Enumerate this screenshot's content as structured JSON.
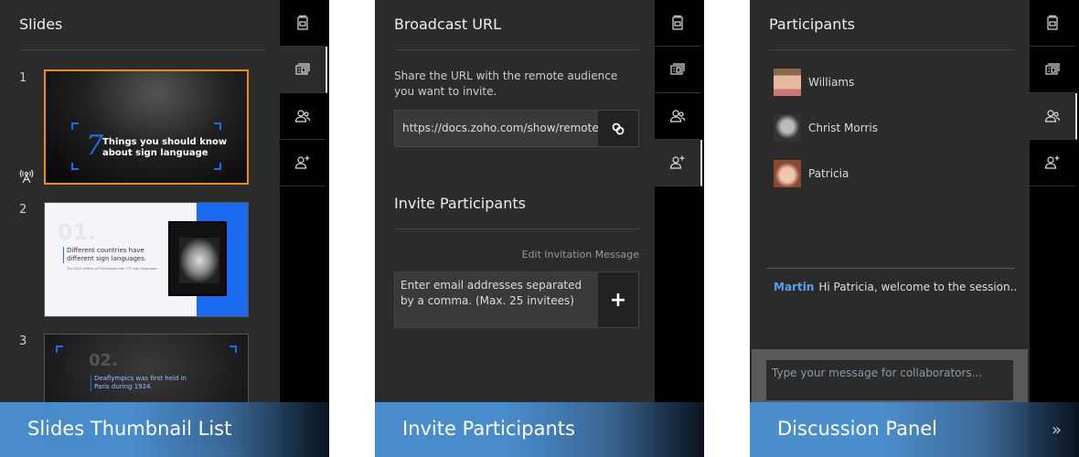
{
  "rail_icons": [
    "notes-icon",
    "slides-icon",
    "participants-icon",
    "add-participant-icon"
  ],
  "colors": {
    "accent": "#4a90d2",
    "selected_border": "#f08a1c",
    "sender": "#5aa0f0",
    "panel": "#2b2b2b"
  },
  "slides_panel": {
    "title": "Slides",
    "caption": "Slides Thumbnail List",
    "active_tab": "slides",
    "slides": [
      {
        "number": "1",
        "big": "7",
        "title": "Things you should know about sign language",
        "selected": true,
        "broadcasting": true
      },
      {
        "number": "2",
        "big": "01.",
        "title": "Different countries have different sign languages.",
        "subtitle": "The 2013 edition of Ethnologue lists 137 sign languages."
      },
      {
        "number": "3",
        "big": "02.",
        "title": "Deaflympics was first held in Paris during 1924."
      }
    ]
  },
  "invite_panel": {
    "title": "Broadcast URL",
    "caption": "Invite Participants",
    "active_tab": "add-participant",
    "description": "Share the URL with the remote audience you want to invite.",
    "url": "https://docs.zoho.com/show/remote.do",
    "invite_title": "Invite Participants",
    "edit_link": "Edit Invitation Message",
    "email_placeholder": "Enter email addresses separated by a comma. (Max. 25 invitees)",
    "add_label": "+"
  },
  "discussion_panel": {
    "title": "Participants",
    "caption": "Discussion Panel",
    "active_tab": "participants",
    "participants": [
      {
        "name": "Williams"
      },
      {
        "name": "Christ Morris"
      },
      {
        "name": "Patricia"
      }
    ],
    "messages": [
      {
        "sender": "Martin",
        "text": "Hi Patricia, welcome to the session.."
      }
    ],
    "input_placeholder": "Type your message for collaborators...",
    "collapse_label": "»"
  }
}
